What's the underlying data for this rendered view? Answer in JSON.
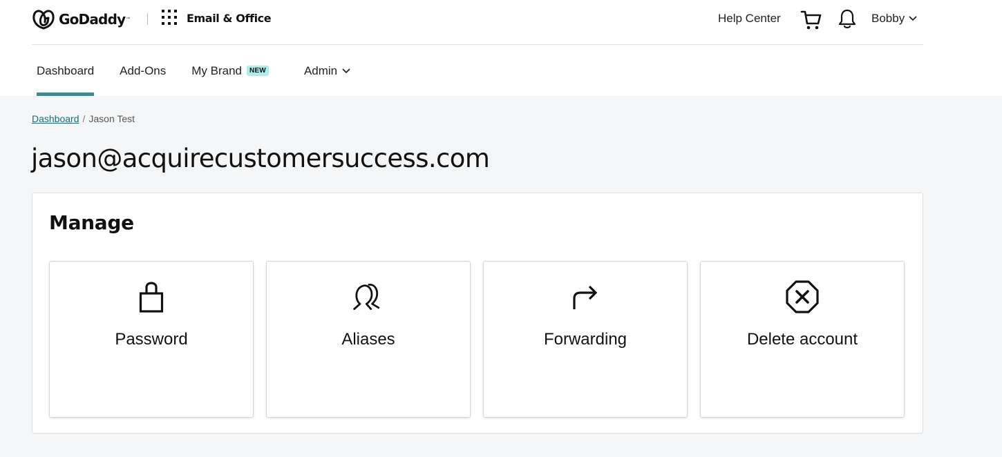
{
  "header": {
    "brand": "GoDaddy",
    "product": "Email & Office",
    "help_center": "Help Center",
    "user_name": "Bobby",
    "icons": {
      "logo": "godaddy-logo",
      "apps": "apps-grid-icon",
      "cart": "cart-icon",
      "notifications": "bell-icon",
      "user_dropdown": "chevron-down-icon"
    }
  },
  "nav": {
    "items": [
      {
        "label": "Dashboard",
        "active": true
      },
      {
        "label": "Add-Ons",
        "active": false
      },
      {
        "label": "My Brand",
        "badge": "NEW",
        "active": false
      },
      {
        "label": "Admin",
        "dropdown": true,
        "active": false
      }
    ]
  },
  "breadcrumb": {
    "link": "Dashboard",
    "separator": "/",
    "current": "Jason Test"
  },
  "page": {
    "title": "jason@acquirecustomersuccess.com"
  },
  "manage": {
    "title": "Manage",
    "cards": [
      {
        "label": "Password",
        "icon": "lock-icon"
      },
      {
        "label": "Aliases",
        "icon": "users-icon"
      },
      {
        "label": "Forwarding",
        "icon": "forward-arrow-icon"
      },
      {
        "label": "Delete account",
        "icon": "delete-octagon-icon"
      }
    ]
  },
  "colors": {
    "accent": "#3f8a8e",
    "link": "#1c6b74",
    "badge_bg": "#a8f0ee",
    "page_bg": "#f5f6f7"
  }
}
